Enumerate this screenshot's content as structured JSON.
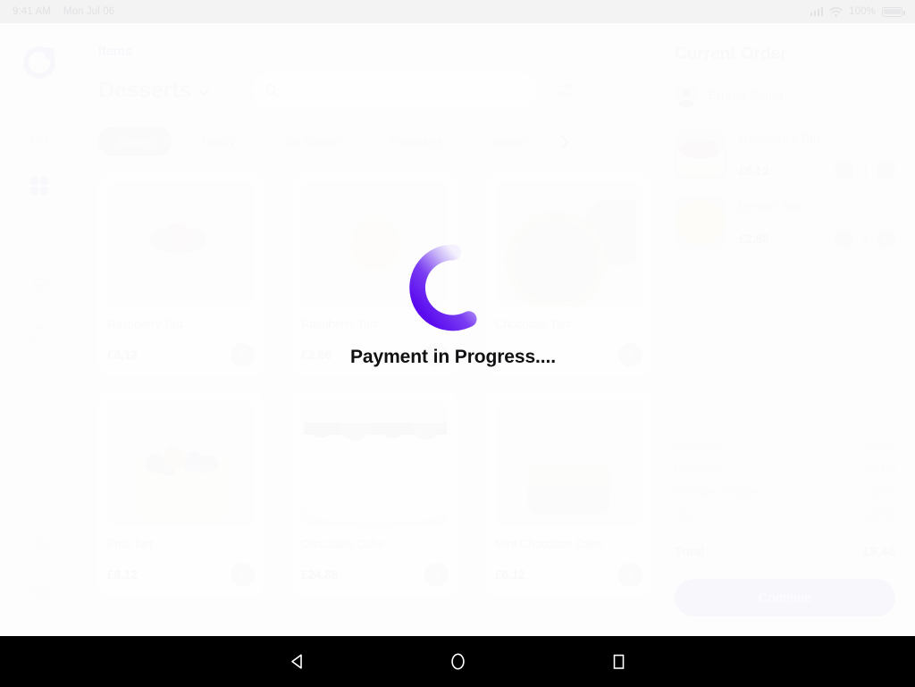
{
  "status_bar": {
    "time": "9:41 AM",
    "date": "Mon Jul 06",
    "battery_percent": "100%",
    "icons": [
      "signal-icon",
      "wifi-icon",
      "battery-icon"
    ]
  },
  "sidebar": {
    "logo": "app-logo-ring",
    "items": [
      {
        "name": "home",
        "icon": "home-icon",
        "active": false
      },
      {
        "name": "items",
        "icon": "grid-icon",
        "active": true
      },
      {
        "name": "bookmarks",
        "icon": "bookmark-icon",
        "active": false
      },
      {
        "name": "orders",
        "icon": "cart-icon",
        "active": false
      },
      {
        "name": "messages",
        "icon": "chat-icon",
        "active": false
      }
    ],
    "bottom_items": [
      {
        "name": "settings",
        "icon": "gear-icon"
      },
      {
        "name": "power",
        "icon": "power-icon"
      }
    ]
  },
  "main": {
    "breadcrumb": "Items",
    "title": "Desserts",
    "search": {
      "value": "",
      "placeholder": ""
    },
    "filter_icon": "sliders-icon",
    "categories": [
      {
        "label": "Cakes",
        "active": true
      },
      {
        "label": "Pastry",
        "active": false
      },
      {
        "label": "Ice Cream",
        "active": false
      },
      {
        "label": "Pancakes",
        "active": false
      },
      {
        "label": "Vegan",
        "active": false
      }
    ],
    "categories_next_icon": "chevron-right-icon",
    "products": [
      {
        "name": "Raspberry Tart",
        "price": "£8,12",
        "image": "raspberry-tart"
      },
      {
        "name": "Raspberry Tart",
        "price": "£2,86",
        "image": "lemon-tart"
      },
      {
        "name": "Chocolate Tart",
        "price": "£6,12",
        "image": "chocolate-tart"
      },
      {
        "name": "Fruit Tart",
        "price": "£6,12",
        "image": "fruit-tart"
      },
      {
        "name": "Chocolate Cake",
        "price": "£24,86",
        "image": "chocolate-cake"
      },
      {
        "name": "Mini Chocolate Cake",
        "price": "£6,12",
        "image": "mini-chocolate-cake"
      }
    ],
    "add_button_label": "+"
  },
  "order": {
    "title": "Current Order",
    "customer": "Emma Wang",
    "items": [
      {
        "name": "Raspberry Tart",
        "price": "£6,12",
        "qty": "1",
        "image": "raspberry-tart"
      },
      {
        "name": "Lemon Tart",
        "price": "£2,86",
        "qty": "1",
        "image": "lemon-tart"
      }
    ],
    "decrement_label": "−",
    "increment_label": "+",
    "totals": [
      {
        "label": "Subtotal",
        "value": "£8.98"
      },
      {
        "label": "Discount",
        "value": "£0.00"
      },
      {
        "label": "Service Charge",
        "value": "20%"
      },
      {
        "label": "Tax",
        "value": "£0.50"
      }
    ],
    "grand_total": {
      "label": "Total",
      "value": "£9,48"
    },
    "continue_label": "Continue"
  },
  "overlay": {
    "message": "Payment in Progress....",
    "spinner_icon": "loading-spinner-icon",
    "spinner_color_start": "#5b0cef",
    "spinner_color_end": "#f3f0fd"
  },
  "nav_bar": {
    "back": "back-triangle-icon",
    "home": "home-circle-icon",
    "recents": "recents-square-icon"
  },
  "theme": {
    "accent": "#5b0cef",
    "accent_light": "#ddd6ef",
    "page_bg": "#f3f3f4",
    "panel_bg": "#f6f6f7"
  }
}
